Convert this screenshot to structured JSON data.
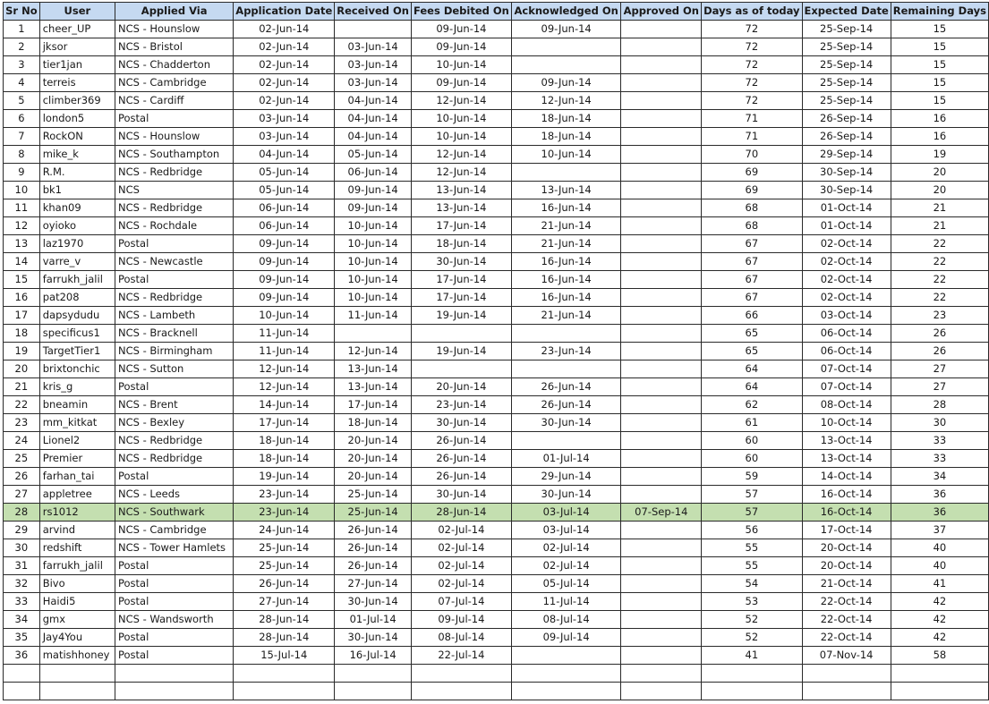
{
  "headers": [
    "Sr No",
    "User",
    "Applied Via",
    "Application Date",
    "Received On",
    "Fees Debited On",
    "Acknowledged On",
    "Approved On",
    "Days as of today",
    "Expected Date",
    "Remaining Days"
  ],
  "highlight_color": "#c4dfb0",
  "header_color": "#c5d9f1",
  "highlighted_row": "28",
  "rows": [
    [
      "1",
      "cheer_UP",
      "NCS - Hounslow",
      "02-Jun-14",
      "",
      "09-Jun-14",
      "09-Jun-14",
      "",
      "72",
      "25-Sep-14",
      "15"
    ],
    [
      "2",
      "jksor",
      "NCS - Bristol",
      "02-Jun-14",
      "03-Jun-14",
      "09-Jun-14",
      "",
      "",
      "72",
      "25-Sep-14",
      "15"
    ],
    [
      "3",
      "tier1jan",
      "NCS - Chadderton",
      "02-Jun-14",
      "03-Jun-14",
      "10-Jun-14",
      "",
      "",
      "72",
      "25-Sep-14",
      "15"
    ],
    [
      "4",
      "terreis",
      "NCS - Cambridge",
      "02-Jun-14",
      "03-Jun-14",
      "09-Jun-14",
      "09-Jun-14",
      "",
      "72",
      "25-Sep-14",
      "15"
    ],
    [
      "5",
      "climber369",
      "NCS - Cardiff",
      "02-Jun-14",
      "04-Jun-14",
      "12-Jun-14",
      "12-Jun-14",
      "",
      "72",
      "25-Sep-14",
      "15"
    ],
    [
      "6",
      "london5",
      "Postal",
      "03-Jun-14",
      "04-Jun-14",
      "10-Jun-14",
      "18-Jun-14",
      "",
      "71",
      "26-Sep-14",
      "16"
    ],
    [
      "7",
      "RockON",
      "NCS - Hounslow",
      "03-Jun-14",
      "04-Jun-14",
      "10-Jun-14",
      "18-Jun-14",
      "",
      "71",
      "26-Sep-14",
      "16"
    ],
    [
      "8",
      "mike_k",
      "NCS - Southampton",
      "04-Jun-14",
      "05-Jun-14",
      "12-Jun-14",
      "10-Jun-14",
      "",
      "70",
      "29-Sep-14",
      "19"
    ],
    [
      "9",
      "R.M.",
      "NCS - Redbridge",
      "05-Jun-14",
      "06-Jun-14",
      "12-Jun-14",
      "",
      "",
      "69",
      "30-Sep-14",
      "20"
    ],
    [
      "10",
      "bk1",
      "NCS",
      "05-Jun-14",
      "09-Jun-14",
      "13-Jun-14",
      "13-Jun-14",
      "",
      "69",
      "30-Sep-14",
      "20"
    ],
    [
      "11",
      "khan09",
      "NCS - Redbridge",
      "06-Jun-14",
      "09-Jun-14",
      "13-Jun-14",
      "16-Jun-14",
      "",
      "68",
      "01-Oct-14",
      "21"
    ],
    [
      "12",
      "oyioko",
      "NCS - Rochdale",
      "06-Jun-14",
      "10-Jun-14",
      "17-Jun-14",
      "21-Jun-14",
      "",
      "68",
      "01-Oct-14",
      "21"
    ],
    [
      "13",
      "laz1970",
      "Postal",
      "09-Jun-14",
      "10-Jun-14",
      "18-Jun-14",
      "21-Jun-14",
      "",
      "67",
      "02-Oct-14",
      "22"
    ],
    [
      "14",
      "varre_v",
      "NCS - Newcastle",
      "09-Jun-14",
      "10-Jun-14",
      "30-Jun-14",
      "16-Jun-14",
      "",
      "67",
      "02-Oct-14",
      "22"
    ],
    [
      "15",
      "farrukh_jalil",
      "Postal",
      "09-Jun-14",
      "10-Jun-14",
      "17-Jun-14",
      "16-Jun-14",
      "",
      "67",
      "02-Oct-14",
      "22"
    ],
    [
      "16",
      "pat208",
      "NCS - Redbridge",
      "09-Jun-14",
      "10-Jun-14",
      "17-Jun-14",
      "16-Jun-14",
      "",
      "67",
      "02-Oct-14",
      "22"
    ],
    [
      "17",
      "dapsydudu",
      "NCS - Lambeth",
      "10-Jun-14",
      "11-Jun-14",
      "19-Jun-14",
      "21-Jun-14",
      "",
      "66",
      "03-Oct-14",
      "23"
    ],
    [
      "18",
      "specificus1",
      "NCS - Bracknell",
      "11-Jun-14",
      "",
      "",
      "",
      "",
      "65",
      "06-Oct-14",
      "26"
    ],
    [
      "19",
      "TargetTier1",
      "NCS - Birmingham",
      "11-Jun-14",
      "12-Jun-14",
      "19-Jun-14",
      "23-Jun-14",
      "",
      "65",
      "06-Oct-14",
      "26"
    ],
    [
      "20",
      "brixtonchic",
      "NCS - Sutton",
      "12-Jun-14",
      "13-Jun-14",
      "",
      "",
      "",
      "64",
      "07-Oct-14",
      "27"
    ],
    [
      "21",
      "kris_g",
      "Postal",
      "12-Jun-14",
      "13-Jun-14",
      "20-Jun-14",
      "26-Jun-14",
      "",
      "64",
      "07-Oct-14",
      "27"
    ],
    [
      "22",
      "bneamin",
      "NCS - Brent",
      "14-Jun-14",
      "17-Jun-14",
      "23-Jun-14",
      "26-Jun-14",
      "",
      "62",
      "08-Oct-14",
      "28"
    ],
    [
      "23",
      "mm_kitkat",
      "NCS - Bexley",
      "17-Jun-14",
      "18-Jun-14",
      "30-Jun-14",
      "30-Jun-14",
      "",
      "61",
      "10-Oct-14",
      "30"
    ],
    [
      "24",
      "Lionel2",
      "NCS - Redbridge",
      "18-Jun-14",
      "20-Jun-14",
      "26-Jun-14",
      "",
      "",
      "60",
      "13-Oct-14",
      "33"
    ],
    [
      "25",
      "Premier",
      "NCS - Redbridge",
      "18-Jun-14",
      "20-Jun-14",
      "26-Jun-14",
      "01-Jul-14",
      "",
      "60",
      "13-Oct-14",
      "33"
    ],
    [
      "26",
      "farhan_tai",
      "Postal",
      "19-Jun-14",
      "20-Jun-14",
      "26-Jun-14",
      "29-Jun-14",
      "",
      "59",
      "14-Oct-14",
      "34"
    ],
    [
      "27",
      "appletree",
      "NCS - Leeds",
      "23-Jun-14",
      "25-Jun-14",
      "30-Jun-14",
      "30-Jun-14",
      "",
      "57",
      "16-Oct-14",
      "36"
    ],
    [
      "28",
      "rs1012",
      "NCS - Southwark",
      "23-Jun-14",
      "25-Jun-14",
      "28-Jun-14",
      "03-Jul-14",
      "07-Sep-14",
      "57",
      "16-Oct-14",
      "36"
    ],
    [
      "29",
      "arvind",
      "NCS - Cambridge",
      "24-Jun-14",
      "26-Jun-14",
      "02-Jul-14",
      "03-Jul-14",
      "",
      "56",
      "17-Oct-14",
      "37"
    ],
    [
      "30",
      "redshift",
      "NCS - Tower Hamlets",
      "25-Jun-14",
      "26-Jun-14",
      "02-Jul-14",
      "02-Jul-14",
      "",
      "55",
      "20-Oct-14",
      "40"
    ],
    [
      "31",
      "farrukh_jalil",
      "Postal",
      "25-Jun-14",
      "26-Jun-14",
      "02-Jul-14",
      "02-Jul-14",
      "",
      "55",
      "20-Oct-14",
      "40"
    ],
    [
      "32",
      "Bivo",
      "Postal",
      "26-Jun-14",
      "27-Jun-14",
      "02-Jul-14",
      "05-Jul-14",
      "",
      "54",
      "21-Oct-14",
      "41"
    ],
    [
      "33",
      "Haidi5",
      "Postal",
      "27-Jun-14",
      "30-Jun-14",
      "07-Jul-14",
      "11-Jul-14",
      "",
      "53",
      "22-Oct-14",
      "42"
    ],
    [
      "34",
      "gmx",
      "NCS - Wandsworth",
      "28-Jun-14",
      "01-Jul-14",
      "09-Jul-14",
      "08-Jul-14",
      "",
      "52",
      "22-Oct-14",
      "42"
    ],
    [
      "35",
      "Jay4You",
      "Postal",
      "28-Jun-14",
      "30-Jun-14",
      "08-Jul-14",
      "09-Jul-14",
      "",
      "52",
      "22-Oct-14",
      "42"
    ],
    [
      "36",
      "matishhoney",
      "Postal",
      "15-Jul-14",
      "16-Jul-14",
      "22-Jul-14",
      "",
      "",
      "41",
      "07-Nov-14",
      "58"
    ],
    [
      "",
      "",
      "",
      "",
      "",
      "",
      "",
      "",
      "",
      "",
      ""
    ],
    [
      "",
      "",
      "",
      "",
      "",
      "",
      "",
      "",
      "",
      "",
      ""
    ]
  ]
}
